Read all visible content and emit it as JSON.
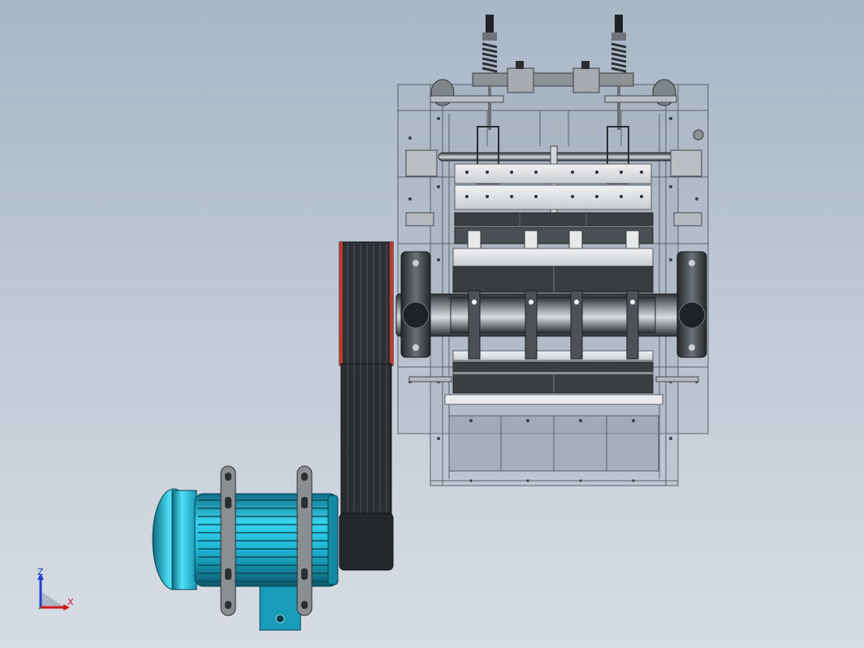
{
  "viewport": {
    "background_top": "#a9b6c6",
    "background_bottom": "#d7dde4"
  },
  "model": {
    "frame_color": "#9aa5b0",
    "rotor_color": "#3e444a",
    "plate_color": "#d8dcdf",
    "motor_color": "#1fb6d3",
    "pulley_color": "#2c2f33",
    "pulley_accent": "#c0392b",
    "icons": [
      "crusher-housing",
      "rotor-shaft",
      "hammer",
      "bearing-housing",
      "belt-pulley",
      "electric-motor",
      "tension-spring"
    ]
  },
  "triad": {
    "z_label": "Z",
    "x_label": "X",
    "z_color": "#1f3fd0",
    "x_color": "#d11a1a",
    "y_color": "#20a020"
  }
}
